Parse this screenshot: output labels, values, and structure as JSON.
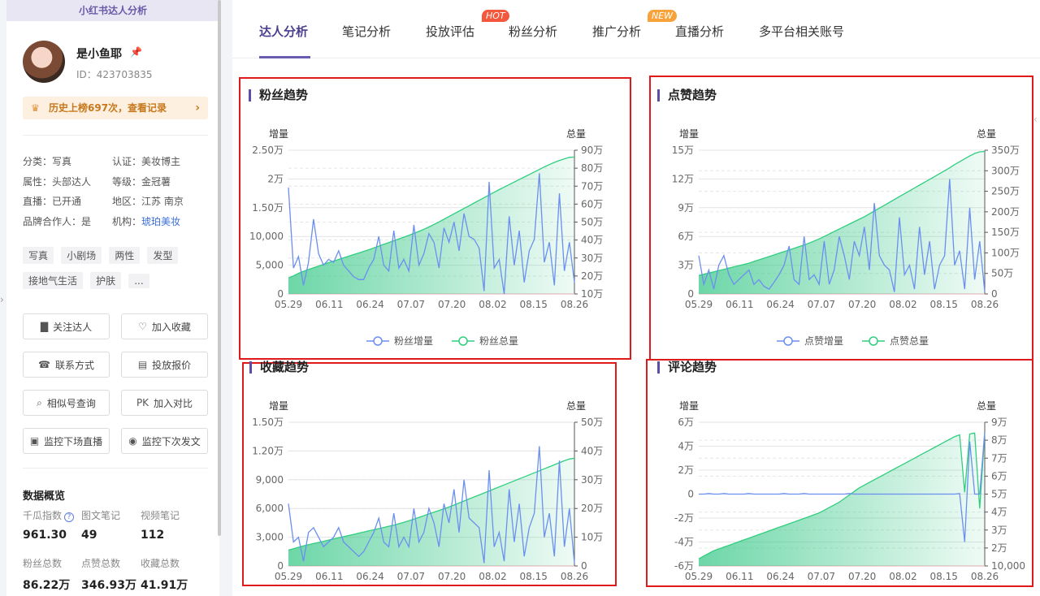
{
  "sidebar": {
    "header": "小红书达人分析",
    "name": "是小鱼耶",
    "id": "ID：423703835",
    "history": "历史上榜697次，查看记录",
    "info": [
      {
        "label": "分类：",
        "value": "写真"
      },
      {
        "label": "认证：",
        "value": "美妆博主"
      },
      {
        "label": "属性：",
        "value": "头部达人"
      },
      {
        "label": "等级：",
        "value": "金冠薯"
      },
      {
        "label": "直播：",
        "value": "已开通"
      },
      {
        "label": "地区：",
        "value": "江苏 南京"
      },
      {
        "label": "品牌合作人：",
        "value": "是"
      },
      {
        "label": "机构：",
        "value": "琥珀美妆"
      }
    ],
    "tags": [
      "写真",
      "小剧场",
      "两性",
      "发型",
      "接地气生活",
      "护肤",
      "..."
    ],
    "buttons": [
      "关注达人",
      "加入收藏",
      "联系方式",
      "投放报价",
      "相似号查询",
      "加入对比",
      "监控下场直播",
      "监控下次发文"
    ],
    "overview": {
      "title": "数据概览",
      "items": [
        {
          "label": "千瓜指数",
          "value": "961.30"
        },
        {
          "label": "图文笔记",
          "value": "49"
        },
        {
          "label": "视频笔记",
          "value": "112"
        },
        {
          "label": "粉丝总数",
          "value": "86.22万"
        },
        {
          "label": "点赞总数",
          "value": "346.93万"
        },
        {
          "label": "收藏总数",
          "value": "41.91万"
        }
      ]
    }
  },
  "tabs": [
    {
      "label": "达人分析",
      "active": true
    },
    {
      "label": "笔记分析"
    },
    {
      "label": "投放评估",
      "badge": "HOT"
    },
    {
      "label": "粉丝分析"
    },
    {
      "label": "推广分析",
      "badge": "NEW"
    },
    {
      "label": "直播分析"
    },
    {
      "label": "多平台相关账号"
    }
  ],
  "colors": {
    "increment": "#6b8ff0",
    "total": "#2fcf7e",
    "accent": "#5b4da8",
    "highlight": "#e0191b"
  },
  "chart_data": [
    {
      "type": "line",
      "title": "粉丝趋势",
      "ylabel_left": "增量",
      "ylabel_right": "总量",
      "x_ticks": [
        "05.29",
        "06.11",
        "06.24",
        "07.07",
        "07.20",
        "08.02",
        "08.15",
        "08.26"
      ],
      "y_left_ticks": [
        "0",
        "5,000",
        "10,000",
        "1.50万",
        "2万",
        "2.50万"
      ],
      "y_left_range": [
        0,
        25000
      ],
      "y_right_ticks": [
        "10万",
        "20万",
        "30万",
        "40万",
        "50万",
        "60万",
        "70万",
        "80万",
        "90万"
      ],
      "y_right_range": [
        100000,
        900000
      ],
      "series": [
        {
          "name": "粉丝增量",
          "axis": "left",
          "values": [
            18500,
            4500,
            6500,
            1500,
            5500,
            13000,
            7000,
            5000,
            6000,
            5500,
            7500,
            5000,
            4000,
            3000,
            2500,
            2500,
            4500,
            6000,
            10000,
            5000,
            4000,
            11000,
            4500,
            6000,
            4000,
            12000,
            5000,
            7000,
            10500,
            9000,
            4500,
            11500,
            9000,
            12500,
            7500,
            14000,
            10000,
            9500,
            8000,
            500,
            19500,
            4500,
            6000,
            0,
            13500,
            5000,
            11000,
            2000,
            7500,
            9500,
            21000,
            5500,
            9000,
            1500,
            17500,
            4000,
            9000,
            2000
          ]
        },
        {
          "name": "粉丝总量",
          "axis": "right",
          "values": [
            189000,
            201000,
            215000,
            226000,
            236000,
            246000,
            255000,
            265000,
            274000,
            283000,
            292000,
            301000,
            310000,
            319000,
            328000,
            337000,
            346000,
            356000,
            366000,
            376000,
            386000,
            396000,
            406000,
            416000,
            426000,
            437000,
            448000,
            460000,
            473000,
            487000,
            501000,
            516000,
            531000,
            546000,
            561000,
            576000,
            591000,
            606000,
            621000,
            636000,
            651000,
            666000,
            681000,
            695000,
            709000,
            723000,
            737000,
            751000,
            765000,
            779000,
            793000,
            807000,
            820000,
            832000,
            843000,
            852000,
            860000,
            862200
          ]
        }
      ]
    },
    {
      "type": "line",
      "title": "点赞趋势",
      "ylabel_left": "增量",
      "ylabel_right": "总量",
      "x_ticks": [
        "05.29",
        "06.11",
        "06.24",
        "07.07",
        "07.20",
        "08.02",
        "08.15",
        "08.26"
      ],
      "y_left_ticks": [
        "0",
        "3万",
        "6万",
        "9万",
        "12万",
        "15万"
      ],
      "y_left_range": [
        0,
        150000
      ],
      "y_right_ticks": [
        "0",
        "50万",
        "100万",
        "150万",
        "200万",
        "250万",
        "300万",
        "350万"
      ],
      "y_right_range": [
        0,
        3500000
      ],
      "series": [
        {
          "name": "点赞增量",
          "axis": "left",
          "values": [
            40000,
            10000,
            25000,
            5000,
            30000,
            40000,
            20000,
            10000,
            15000,
            20000,
            25000,
            10000,
            15000,
            8000,
            5000,
            12000,
            20000,
            30000,
            50000,
            15000,
            10000,
            60000,
            15000,
            20000,
            10000,
            55000,
            10000,
            25000,
            60000,
            40000,
            15000,
            55000,
            40000,
            70000,
            25000,
            95000,
            40000,
            30000,
            25000,
            2000,
            80000,
            20000,
            30000,
            5000,
            70000,
            20000,
            55000,
            5000,
            30000,
            40000,
            120000,
            30000,
            45000,
            5000,
            90000,
            15000,
            55000,
            2000
          ]
        },
        {
          "name": "点赞总量",
          "axis": "right",
          "values": [
            450000,
            480000,
            510000,
            540000,
            570000,
            600000,
            630000,
            660000,
            690000,
            720000,
            750000,
            790000,
            830000,
            870000,
            910000,
            950000,
            990000,
            1030000,
            1070000,
            1110000,
            1150000,
            1190000,
            1240000,
            1290000,
            1340000,
            1400000,
            1460000,
            1520000,
            1580000,
            1640000,
            1700000,
            1760000,
            1820000,
            1880000,
            1950000,
            2020000,
            2090000,
            2160000,
            2230000,
            2300000,
            2370000,
            2440000,
            2510000,
            2580000,
            2650000,
            2720000,
            2790000,
            2860000,
            2930000,
            3000000,
            3070000,
            3150000,
            3220000,
            3290000,
            3360000,
            3420000,
            3460000,
            3469300
          ]
        }
      ]
    },
    {
      "type": "line",
      "title": "收藏趋势",
      "ylabel_left": "增量",
      "ylabel_right": "总量",
      "x_ticks": [
        "05.29",
        "06.11",
        "06.24",
        "07.07",
        "07.20",
        "08.02",
        "08.15",
        "08.26"
      ],
      "y_left_ticks": [
        "0",
        "3,000",
        "6,000",
        "9,000",
        "1.20万",
        "1.50万"
      ],
      "y_left_range": [
        0,
        15000
      ],
      "y_right_ticks": [
        "0",
        "10万",
        "20万",
        "30万",
        "40万",
        "50万"
      ],
      "y_right_range": [
        0,
        500000
      ],
      "series": [
        {
          "name": "收藏增量",
          "axis": "left",
          "values": [
            6500,
            2500,
            3000,
            500,
            3500,
            4000,
            3000,
            2000,
            2500,
            3000,
            4000,
            2500,
            2000,
            1500,
            1000,
            1500,
            2500,
            3500,
            5000,
            2500,
            2000,
            5500,
            2000,
            3000,
            2000,
            6000,
            2500,
            3500,
            6000,
            4500,
            2000,
            6500,
            4500,
            8000,
            3500,
            9000,
            5000,
            4500,
            4000,
            300,
            10000,
            2000,
            3500,
            500,
            8000,
            2500,
            6500,
            1000,
            4000,
            5500,
            12500,
            3000,
            5500,
            1000,
            11000,
            2000,
            6000,
            300
          ]
        },
        {
          "name": "收藏总量",
          "axis": "right",
          "values": [
            55000,
            60000,
            65000,
            70000,
            74000,
            78000,
            82000,
            86000,
            90000,
            94000,
            98000,
            102000,
            106000,
            110000,
            114000,
            118000,
            122000,
            126000,
            130000,
            134000,
            138000,
            142000,
            147000,
            152000,
            157000,
            163000,
            169000,
            175000,
            181000,
            187000,
            193000,
            199000,
            205000,
            212000,
            219000,
            226000,
            233000,
            240000,
            247000,
            254000,
            261000,
            268000,
            275000,
            282000,
            289000,
            296000,
            303000,
            310000,
            317000,
            324000,
            331000,
            338000,
            345000,
            352000,
            359000,
            366000,
            372000,
            375000
          ]
        }
      ]
    },
    {
      "type": "line",
      "title": "评论趋势",
      "ylabel_left": "增量",
      "ylabel_right": "总量",
      "x_ticks": [
        "05.29",
        "06.11",
        "06.24",
        "07.07",
        "07.20",
        "08.02",
        "08.15",
        "08.26"
      ],
      "y_left_ticks": [
        "-6万",
        "-4万",
        "-2万",
        "0",
        "2万",
        "4万",
        "6万"
      ],
      "y_left_range": [
        -60000,
        60000
      ],
      "y_right_ticks": [
        "10,000",
        "2万",
        "3万",
        "4万",
        "5万",
        "6万",
        "7万",
        "8万",
        "9万"
      ],
      "y_right_range": [
        10000,
        90000
      ],
      "series": [
        {
          "name": "评论增量",
          "axis": "left",
          "values": [
            0,
            0,
            500,
            0,
            0,
            500,
            0,
            0,
            0,
            0,
            500,
            0,
            0,
            0,
            0,
            0,
            0,
            500,
            0,
            0,
            0,
            500,
            0,
            0,
            0,
            0,
            0,
            0,
            0,
            0,
            500,
            0,
            0,
            0,
            0,
            0,
            0,
            0,
            0,
            0,
            0,
            0,
            0,
            0,
            0,
            0,
            0,
            0,
            0,
            0,
            0,
            0,
            500,
            -40000,
            44000,
            0,
            0,
            52000
          ]
        },
        {
          "name": "评论总量",
          "axis": "right",
          "values": [
            14000,
            15500,
            17000,
            18500,
            19500,
            20500,
            21500,
            22500,
            23500,
            24500,
            25500,
            26500,
            27500,
            28500,
            29500,
            30500,
            31500,
            32500,
            33500,
            34500,
            35500,
            36500,
            37500,
            38500,
            39500,
            41000,
            42500,
            44000,
            45500,
            47500,
            49500,
            51500,
            53500,
            55000,
            56500,
            58000,
            59500,
            61000,
            62500,
            64000,
            65500,
            67000,
            68500,
            70000,
            71500,
            73000,
            74500,
            76000,
            77500,
            79000,
            80500,
            82000,
            83000,
            51000,
            83500,
            84000,
            42000,
            84500
          ]
        }
      ]
    }
  ]
}
